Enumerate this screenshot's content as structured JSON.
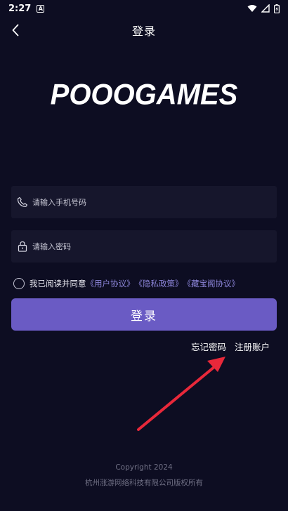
{
  "status_bar": {
    "time": "2:27",
    "notification_letter": "A"
  },
  "nav": {
    "title": "登录"
  },
  "logo": {
    "text": "POOOGAMES"
  },
  "phone_field": {
    "placeholder": "请输入手机号码",
    "icon": "phone-icon"
  },
  "password_field": {
    "placeholder": "请输入密码",
    "icon": "lock-icon"
  },
  "agreement": {
    "prefix": "我已阅读并同意",
    "user_agreement": "《用户协议》",
    "privacy_policy": "《隐私政策》",
    "treasure_agreement": "《藏宝阁协议》"
  },
  "login_button": {
    "label": "登录"
  },
  "links": {
    "forgot_password": "忘记密码",
    "register": "注册账户"
  },
  "footer": {
    "copyright": "Copyright 2024",
    "company": "杭州涨游网络科技有限公司版权所有"
  },
  "colors": {
    "background": "#0d0d22",
    "accent": "#6a5bc4",
    "link": "#8b84d8",
    "annotation_arrow": "#e8283a"
  }
}
